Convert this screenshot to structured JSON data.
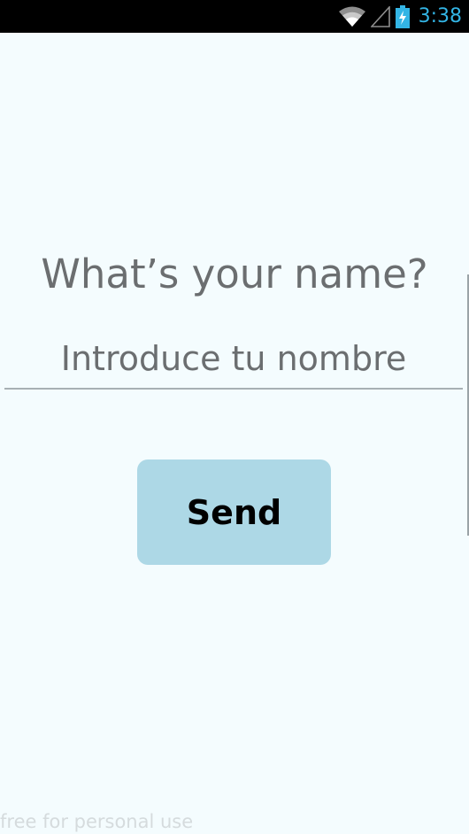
{
  "status_bar": {
    "time": "3:38",
    "icons": [
      "wifi-icon",
      "signal-icon",
      "battery-charging-icon"
    ],
    "clock_color": "#33b5e5"
  },
  "main": {
    "question": "What’s your name?",
    "name_input": {
      "value": "",
      "placeholder": "Introduce tu nombre"
    },
    "send_label": "Send"
  },
  "watermark": "free for personal use",
  "colors": {
    "background": "#f4fcfe",
    "button": "#add8e6",
    "text": "#6b6e70"
  }
}
